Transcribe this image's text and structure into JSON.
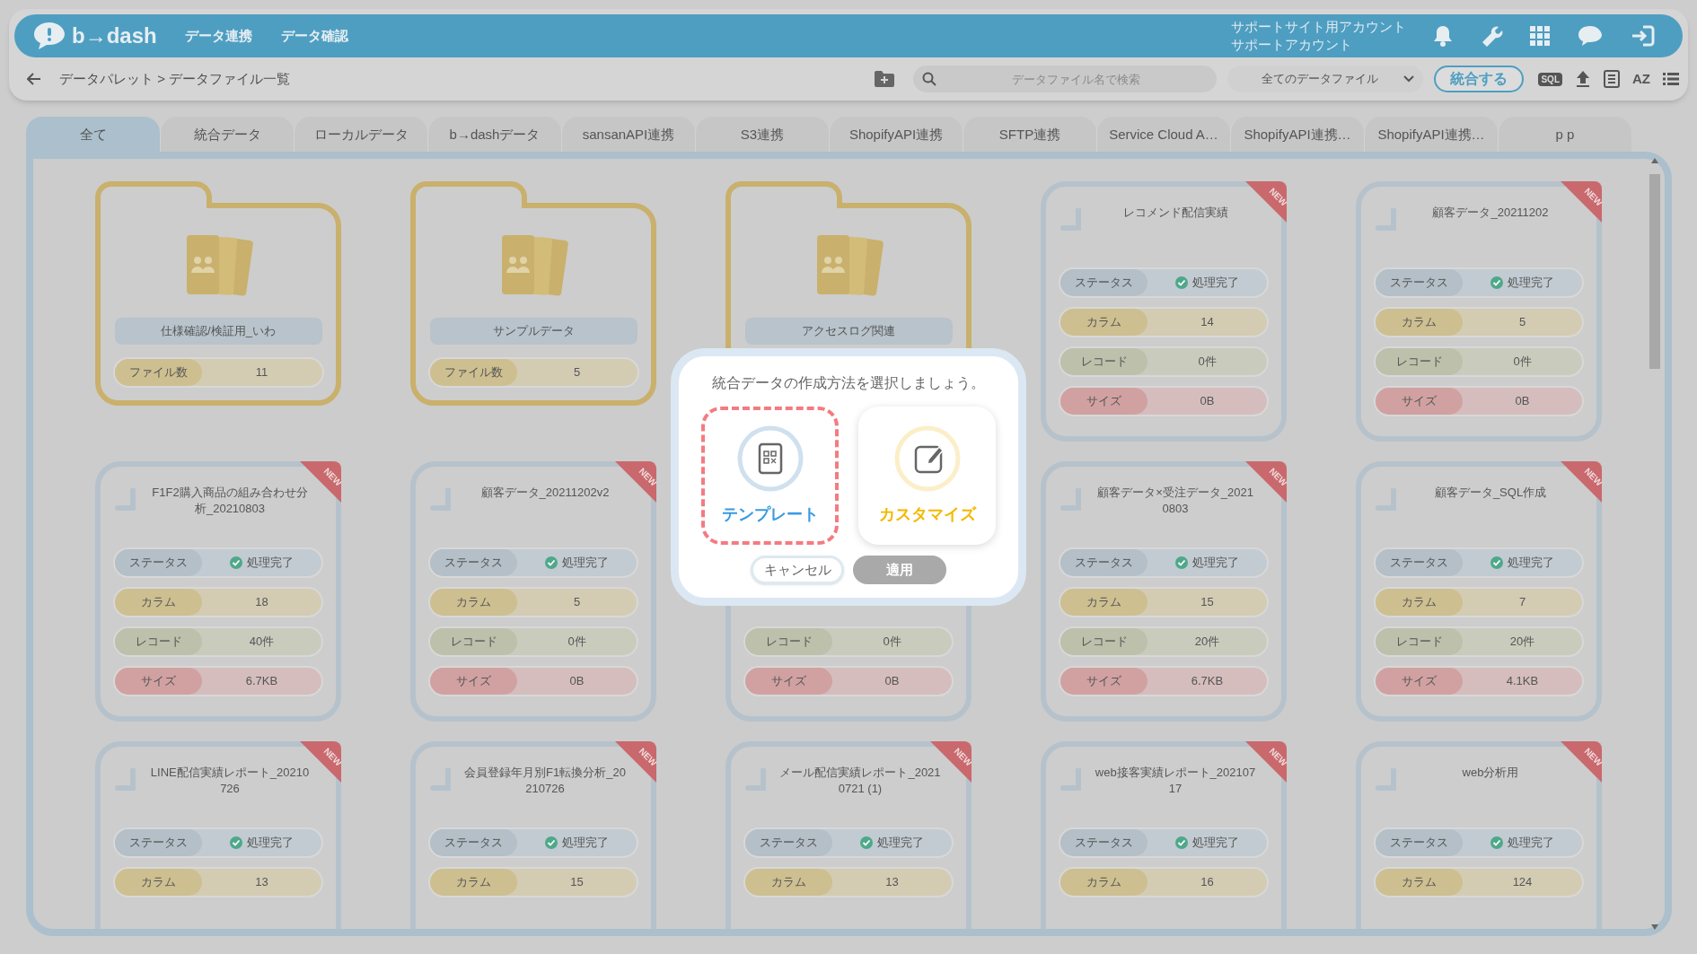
{
  "header": {
    "logo": "b→dash",
    "nav": [
      {
        "label": "データ連携"
      },
      {
        "label": "データ確認"
      }
    ],
    "account": [
      "サポートサイト用アカウント",
      "サポートアカウント"
    ]
  },
  "toolbar": {
    "breadcrumb": "データパレット > データファイル一覧",
    "search": {
      "placeholder": "データファイル名で検索"
    },
    "filter": "全てのデータファイル",
    "merge_button": "統合する",
    "sql_label": "SQL",
    "sort_label": "AZ"
  },
  "tabs": [
    {
      "label": "全て",
      "selected": true
    },
    {
      "label": "統合データ",
      "selected": false
    },
    {
      "label": "ローカルデータ",
      "selected": false
    },
    {
      "label": "b→dashデータ",
      "selected": false
    },
    {
      "label": "sansanAPI連携",
      "selected": false
    },
    {
      "label": "S3連携",
      "selected": false
    },
    {
      "label": "ShopifyAPI連携",
      "selected": false
    },
    {
      "label": "SFTP連携",
      "selected": false
    },
    {
      "label": "Service Cloud A…",
      "selected": false
    },
    {
      "label": "ShopifyAPI連携…",
      "selected": false
    },
    {
      "label": "ShopifyAPI連携…",
      "selected": false
    },
    {
      "label": "p p",
      "selected": false
    }
  ],
  "cards": [
    {
      "kind": "folder",
      "title": "仕様確認/検証用_いわ",
      "rows": [
        {
          "kind": "count",
          "label": "ファイル数",
          "value": "11"
        }
      ]
    },
    {
      "kind": "folder",
      "title": "サンプルデータ",
      "rows": [
        {
          "kind": "count",
          "label": "ファイル数",
          "value": "5"
        }
      ]
    },
    {
      "kind": "folder",
      "title": "アクセスログ関連"
    },
    {
      "kind": "file",
      "badge": "NEW",
      "title": "レコメンド配信実績",
      "rows": [
        {
          "kind": "status",
          "label": "ステータス",
          "value": "処理完了"
        },
        {
          "kind": "columns",
          "label": "カラム",
          "value": "14"
        },
        {
          "kind": "records",
          "label": "レコード",
          "value": "0件"
        },
        {
          "kind": "size",
          "label": "サイズ",
          "value": "0B"
        }
      ]
    },
    {
      "kind": "file",
      "badge": "NEW",
      "title": "顧客データ_20211202",
      "rows": [
        {
          "kind": "status",
          "label": "ステータス",
          "value": "処理完了"
        },
        {
          "kind": "columns",
          "label": "カラム",
          "value": "5"
        },
        {
          "kind": "records",
          "label": "レコード",
          "value": "0件"
        },
        {
          "kind": "size",
          "label": "サイズ",
          "value": "0B"
        }
      ]
    },
    {
      "kind": "file",
      "badge": "NEW",
      "title": "F1F2購入商品の組み合わせ分析_20210803",
      "rows": [
        {
          "kind": "status",
          "label": "ステータス",
          "value": "処理完了"
        },
        {
          "kind": "columns",
          "label": "カラム",
          "value": "18"
        },
        {
          "kind": "records",
          "label": "レコード",
          "value": "40件"
        },
        {
          "kind": "size",
          "label": "サイズ",
          "value": "6.7KB"
        }
      ]
    },
    {
      "kind": "file",
      "badge": "NEW",
      "title": "顧客データ_20211202v2",
      "rows": [
        {
          "kind": "status",
          "label": "ステータス",
          "value": "処理完了"
        },
        {
          "kind": "columns",
          "label": "カラム",
          "value": "5"
        },
        {
          "kind": "records",
          "label": "レコード",
          "value": "0件"
        },
        {
          "kind": "size",
          "label": "サイズ",
          "value": "0B"
        }
      ]
    },
    {
      "kind": "file",
      "rows": [
        {
          "kind": "records",
          "label": "レコード",
          "value": "0件"
        },
        {
          "kind": "size",
          "label": "サイズ",
          "value": "0B"
        }
      ]
    },
    {
      "kind": "file",
      "badge": "NEW",
      "title": "顧客データ×受注データ_20210803",
      "rows": [
        {
          "kind": "status",
          "label": "ステータス",
          "value": "処理完了"
        },
        {
          "kind": "columns",
          "label": "カラム",
          "value": "15"
        },
        {
          "kind": "records",
          "label": "レコード",
          "value": "20件"
        },
        {
          "kind": "size",
          "label": "サイズ",
          "value": "6.7KB"
        }
      ]
    },
    {
      "kind": "file",
      "badge": "NEW",
      "title": "顧客データ_SQL作成",
      "rows": [
        {
          "kind": "status",
          "label": "ステータス",
          "value": "処理完了"
        },
        {
          "kind": "columns",
          "label": "カラム",
          "value": "7"
        },
        {
          "kind": "records",
          "label": "レコード",
          "value": "20件"
        },
        {
          "kind": "size",
          "label": "サイズ",
          "value": "4.1KB"
        }
      ]
    },
    {
      "kind": "file",
      "badge": "NEW",
      "title": "LINE配信実績レポート_20210726",
      "rows": [
        {
          "kind": "status",
          "label": "ステータス",
          "value": "処理完了"
        },
        {
          "kind": "columns",
          "label": "カラム",
          "value": "13"
        }
      ]
    },
    {
      "kind": "file",
      "badge": "NEW",
      "title": "会員登録年月別F1転換分析_20210726",
      "rows": [
        {
          "kind": "status",
          "label": "ステータス",
          "value": "処理完了"
        },
        {
          "kind": "columns",
          "label": "カラム",
          "value": "15"
        }
      ]
    },
    {
      "kind": "file",
      "badge": "NEW",
      "title": "メール配信実績レポート_20210721 (1)",
      "rows": [
        {
          "kind": "status",
          "label": "ステータス",
          "value": "処理完了"
        },
        {
          "kind": "columns",
          "label": "カラム",
          "value": "13"
        }
      ]
    },
    {
      "kind": "file",
      "badge": "NEW",
      "title": "web接客実績レポート_20210717",
      "rows": [
        {
          "kind": "status",
          "label": "ステータス",
          "value": "処理完了"
        },
        {
          "kind": "columns",
          "label": "カラム",
          "value": "16"
        }
      ]
    },
    {
      "kind": "file",
      "badge": "NEW",
      "title": "web分析用",
      "rows": [
        {
          "kind": "status",
          "label": "ステータス",
          "value": "処理完了"
        },
        {
          "kind": "columns",
          "label": "カラム",
          "value": "124"
        }
      ]
    }
  ],
  "dialog": {
    "title": "統合データの作成方法を選択しましょう。",
    "options": [
      {
        "kind": "template",
        "label": "テンプレート",
        "selected": true
      },
      {
        "kind": "custom",
        "label": "カスタマイズ",
        "selected": false
      }
    ],
    "buttons": [
      {
        "label": "キャンセル",
        "disabled": false
      },
      {
        "label": "適用",
        "disabled": true
      }
    ]
  }
}
